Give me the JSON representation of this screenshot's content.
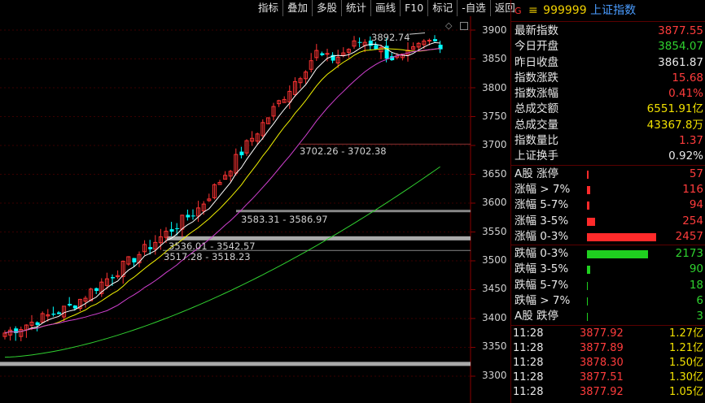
{
  "toolbar": {
    "items": [
      "指标",
      "叠加",
      "多股",
      "统计",
      "画线",
      "F10",
      "标记",
      "-自选",
      "返回"
    ]
  },
  "chart": {
    "y_labels": [
      "3900",
      "3850",
      "3800",
      "3750",
      "3700",
      "3650",
      "3600",
      "3550",
      "3500",
      "3450",
      "3400",
      "3350",
      "3300"
    ],
    "peak_label": "3892.74",
    "gap_annotations": [
      "3702.26 - 3702.38",
      "3583.31 - 3586.97",
      "3536.01 - 3542.57",
      "3517.28 - 3518.23"
    ],
    "colors": {
      "up": "#ff3333",
      "down": "#00ffff",
      "ma5": "#ffffff",
      "ma10": "#f0f000",
      "ma20": "#d040d0",
      "ma60": "#30d030"
    }
  },
  "panel": {
    "header": {
      "flag": "G",
      "menu_icon": "≡",
      "code": "999999",
      "name": "上证指数"
    },
    "stats": [
      {
        "label": "最新指数",
        "value": "3877.55",
        "color": "red"
      },
      {
        "label": "今日开盘",
        "value": "3854.07",
        "color": "green"
      },
      {
        "label": "昨日收盘",
        "value": "3861.87",
        "color": "white"
      },
      {
        "label": "指数涨跌",
        "value": "15.68",
        "color": "red"
      },
      {
        "label": "指数涨幅",
        "value": "0.41%",
        "color": "red"
      },
      {
        "label": "总成交额",
        "value": "6551.91亿",
        "color": "yellow"
      },
      {
        "label": "总成交量",
        "value": "43367.8万",
        "color": "yellow"
      },
      {
        "label": "指数量比",
        "value": "1.37",
        "color": "red"
      },
      {
        "label": "上证换手",
        "value": "0.92%",
        "color": "white"
      }
    ],
    "up_dist": [
      {
        "label": "A股 涨停",
        "value": "57"
      },
      {
        "label": "涨幅 > 7%",
        "value": "116"
      },
      {
        "label": "涨幅 5-7%",
        "value": "94"
      },
      {
        "label": "涨幅 3-5%",
        "value": "254"
      },
      {
        "label": "涨幅 0-3%",
        "value": "2457"
      }
    ],
    "down_dist": [
      {
        "label": "跌幅 0-3%",
        "value": "2173"
      },
      {
        "label": "跌幅 3-5%",
        "value": "90"
      },
      {
        "label": "跌幅 5-7%",
        "value": "18"
      },
      {
        "label": "跌幅 > 7%",
        "value": "6"
      },
      {
        "label": "A股 跌停",
        "value": "3"
      }
    ],
    "ticks": [
      {
        "time": "11:28",
        "price": "3877.92",
        "vol": "1.27亿"
      },
      {
        "time": "11:28",
        "price": "3877.89",
        "vol": "1.21亿"
      },
      {
        "time": "11:28",
        "price": "3878.30",
        "vol": "1.50亿"
      },
      {
        "time": "11:28",
        "price": "3877.51",
        "vol": "1.30亿"
      },
      {
        "time": "11:28",
        "price": "3877.92",
        "vol": "1.05亿"
      }
    ]
  }
}
